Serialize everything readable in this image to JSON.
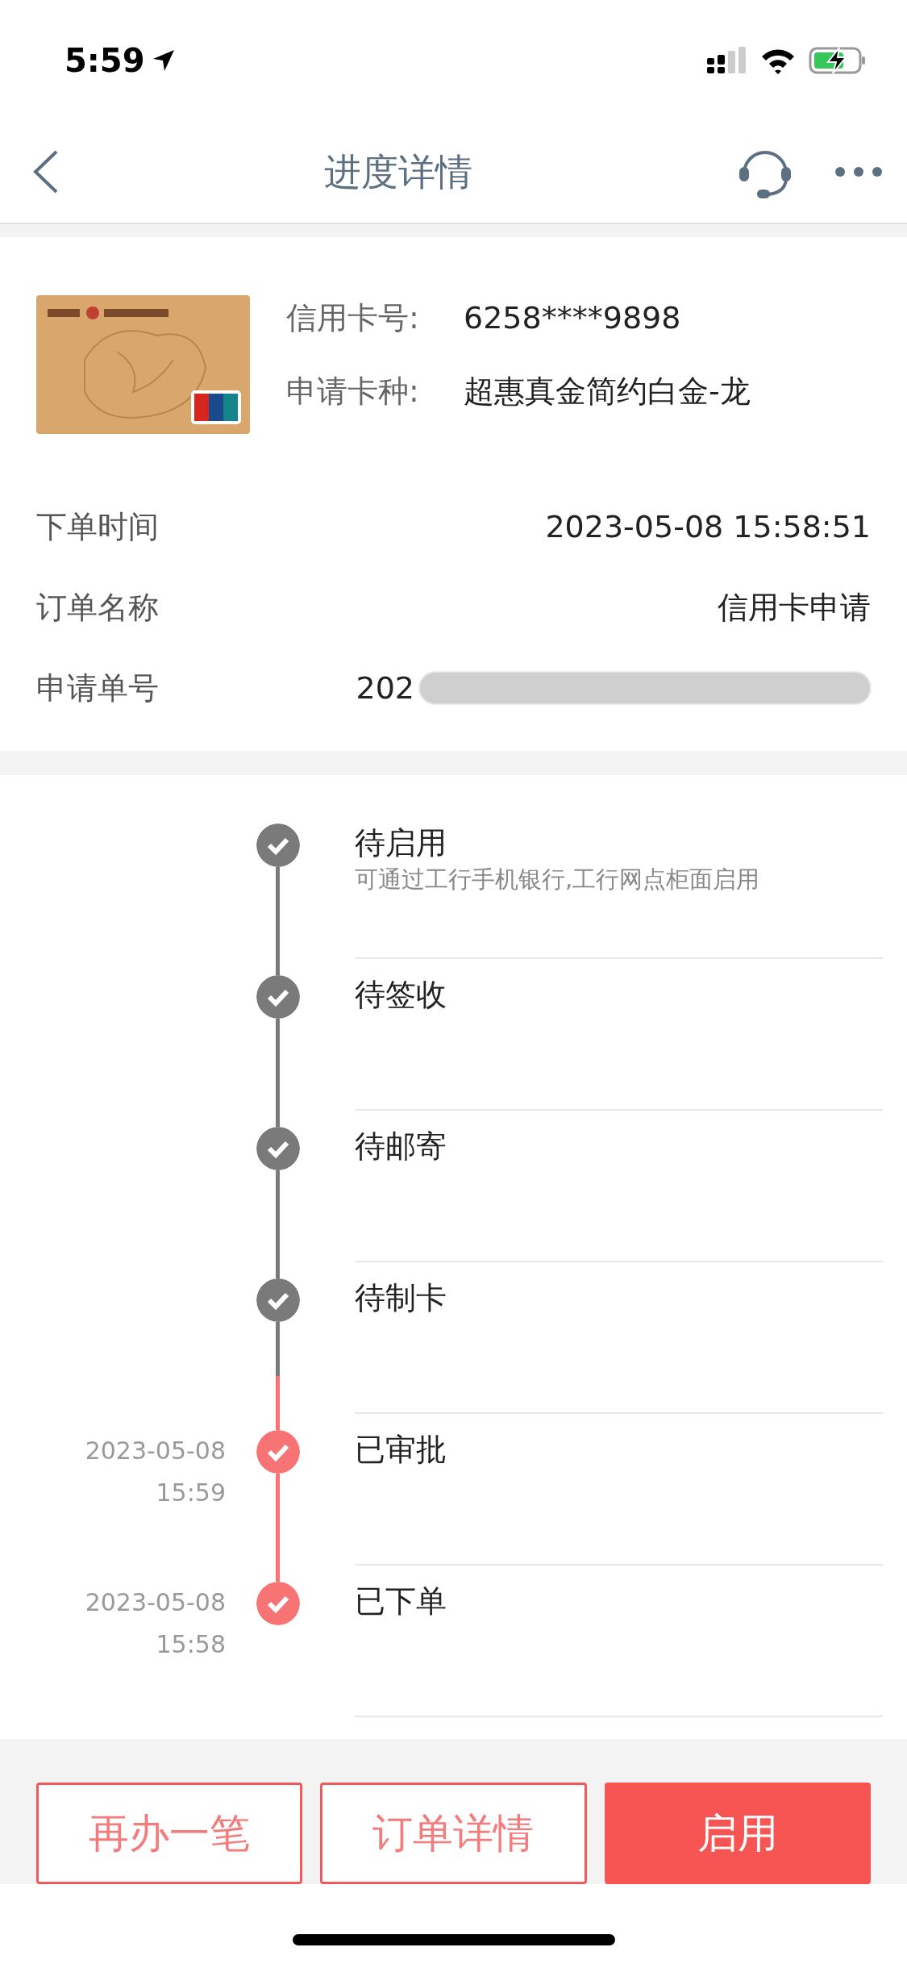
{
  "status_bar": {
    "time": "5:59"
  },
  "header": {
    "title": "进度详情"
  },
  "card": {
    "fields": [
      {
        "label": "信用卡号:",
        "value": "6258****9898"
      },
      {
        "label": "申请卡种:",
        "value": "超惠真金简约白金-龙"
      }
    ]
  },
  "order": {
    "rows": [
      {
        "label": "下单时间",
        "value": "2023-05-08 15:58:51",
        "redacted": false
      },
      {
        "label": "订单名称",
        "value": "信用卡申请",
        "redacted": false
      },
      {
        "label": "申请单号",
        "value": "202",
        "redacted": true
      }
    ]
  },
  "timeline": [
    {
      "title": "待启用",
      "subtitle": "可通过工行手机银行,工行网点柜面启用",
      "highlighted": false
    },
    {
      "title": "待签收",
      "highlighted": false
    },
    {
      "title": "待邮寄",
      "highlighted": false
    },
    {
      "title": "待制卡",
      "highlighted": false
    },
    {
      "title": "已审批",
      "date": "2023-05-08",
      "time": "15:59",
      "highlighted": true
    },
    {
      "title": "已下单",
      "date": "2023-05-08",
      "time": "15:58",
      "highlighted": true
    }
  ],
  "buttons": [
    {
      "label": "再办一笔",
      "kind": "outline"
    },
    {
      "label": "订单详情",
      "kind": "outline"
    },
    {
      "label": "启用",
      "kind": "solid"
    }
  ]
}
